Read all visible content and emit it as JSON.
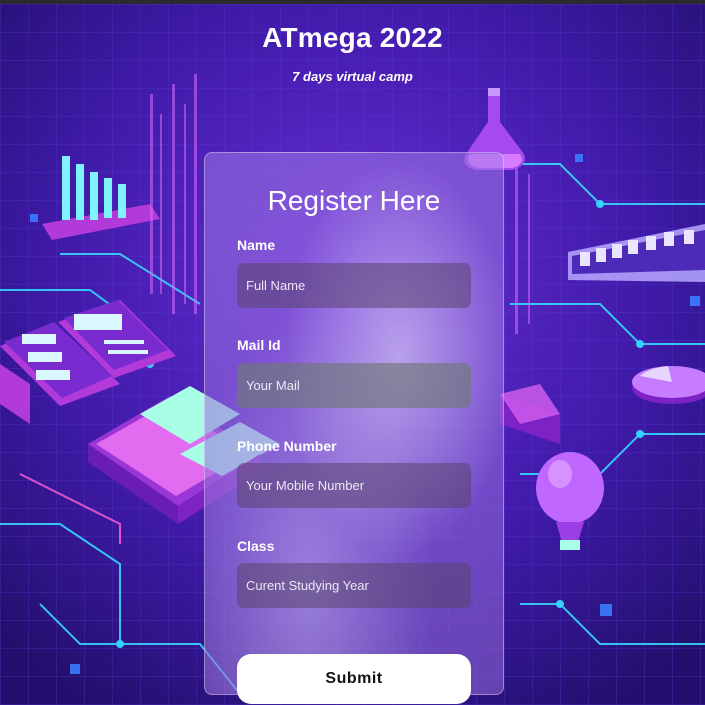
{
  "header": {
    "title": "ATmega 2022",
    "subtitle": "7 days virtual camp"
  },
  "form": {
    "title": "Register Here",
    "fields": [
      {
        "label": "Name",
        "placeholder": "Full Name",
        "value": ""
      },
      {
        "label": "Mail Id",
        "placeholder": "Your Mail",
        "value": ""
      },
      {
        "label": "Phone Number",
        "placeholder": "Your Mobile Number",
        "value": ""
      },
      {
        "label": "Class",
        "placeholder": "Curent Studying Year",
        "value": ""
      }
    ],
    "submit_label": "Submit"
  },
  "colors": {
    "background": "#3a1a9c",
    "accent_neon": "#36d6ff",
    "card_glass": "#a078e6",
    "button": "#ffffff"
  }
}
